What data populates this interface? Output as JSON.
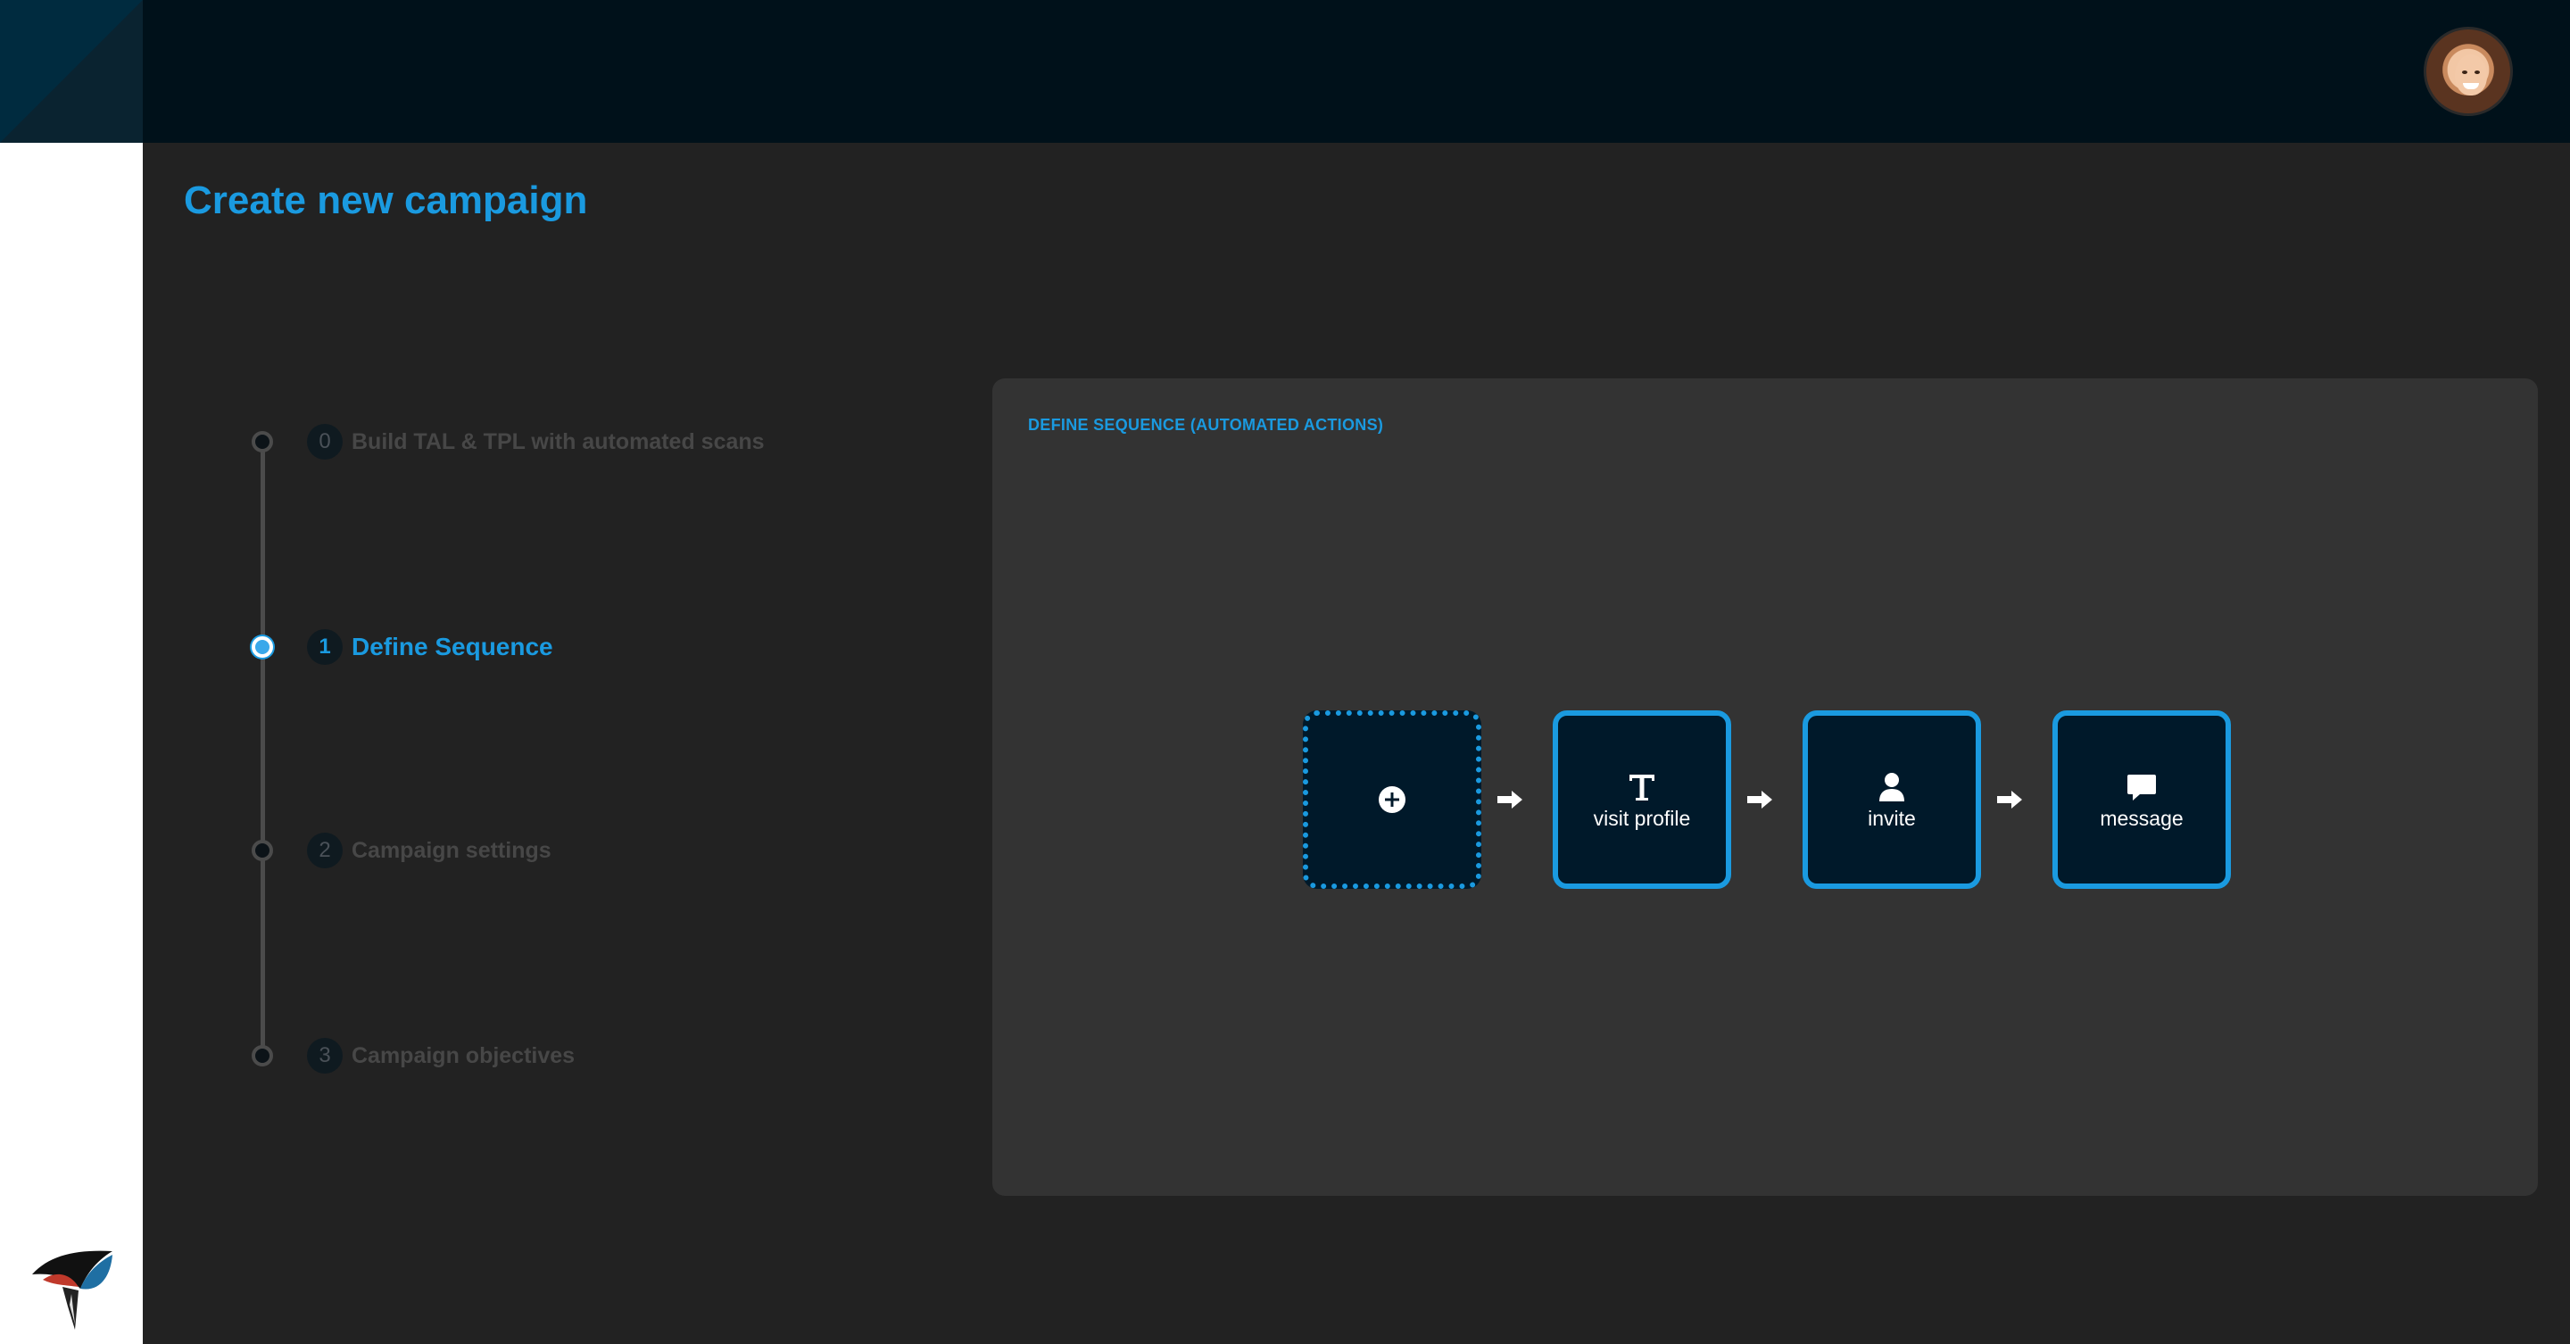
{
  "page": {
    "title": "Create new campaign"
  },
  "header": {
    "avatar": "user-avatar"
  },
  "steps": [
    {
      "num": "0",
      "label": "Build TAL & TPL with automated scans",
      "active": false
    },
    {
      "num": "1",
      "label": "Define Sequence",
      "active": true
    },
    {
      "num": "2",
      "label": "Campaign settings",
      "active": false
    },
    {
      "num": "3",
      "label": "Campaign objectives",
      "active": false
    }
  ],
  "sequence": {
    "title": "DEFINE SEQUENCE (AUTOMATED ACTIONS)",
    "add_icon": "plus-circle-icon",
    "actions": [
      {
        "label": "visit profile",
        "icon": "text-t-icon"
      },
      {
        "label": "invite",
        "icon": "person-icon"
      },
      {
        "label": "message",
        "icon": "chat-bubble-icon"
      }
    ]
  },
  "colors": {
    "accent": "#1a9ae0",
    "header": "#00111a",
    "background": "#222222",
    "panel": "#333333"
  }
}
